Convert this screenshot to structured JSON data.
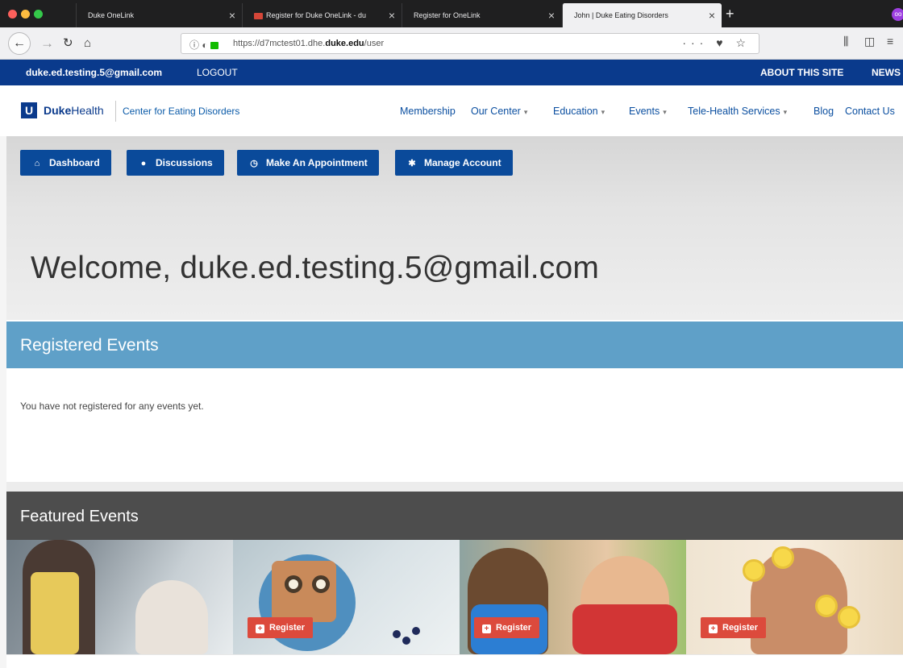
{
  "browser": {
    "tabs": [
      {
        "label": "Duke OneLink",
        "active": false
      },
      {
        "label": "Register for Duke OneLink - du",
        "active": false,
        "icon": "gmail-icon"
      },
      {
        "label": "Register for OneLink",
        "active": false
      },
      {
        "label": "John | Duke Eating Disorders",
        "active": true
      }
    ],
    "close_glyph": "×",
    "new_tab_glyph": "+",
    "url_prefix": "https://d7mctest01.dhe.",
    "url_domain": "duke.edu",
    "url_path": "/user",
    "page_actions": "··· ♥ ☆",
    "ext_badge": "oo"
  },
  "site": {
    "utility": {
      "email": "duke.ed.testing.5@gmail.com",
      "logout": "LOGOUT",
      "about": "ABOUT THIS SITE",
      "news": "NEWS"
    },
    "brand": {
      "logo_letter": "U",
      "duke": "Duke",
      "health": "Health",
      "center": "Center for Eating Disorders"
    },
    "nav": [
      {
        "label": "Membership",
        "dropdown": false
      },
      {
        "label": "Our Center",
        "dropdown": true
      },
      {
        "label": "Education",
        "dropdown": true
      },
      {
        "label": "Events",
        "dropdown": true
      },
      {
        "label": "Tele-Health Services",
        "dropdown": true
      },
      {
        "label": "Blog",
        "dropdown": false
      },
      {
        "label": "Contact Us",
        "dropdown": false
      }
    ],
    "caret": "▾",
    "actions": [
      {
        "label": "Dashboard",
        "icon": "home-icon",
        "glyph": "⌂"
      },
      {
        "label": "Discussions",
        "icon": "chat-icon",
        "glyph": "●"
      },
      {
        "label": "Make An Appointment",
        "icon": "clock-icon",
        "glyph": "◷"
      },
      {
        "label": "Manage Account",
        "icon": "gear-icon",
        "glyph": "✱"
      }
    ],
    "welcome": "Welcome, duke.ed.testing.5@gmail.com",
    "registered_title": "Registered Events",
    "no_events": "You have not registered for any events yet.",
    "featured_title": "Featured Events",
    "register_label": "Register",
    "register_glyph": "+"
  },
  "colors": {
    "duke_blue": "#0a3a8c",
    "button_blue": "#0a4a9a",
    "registered_bar": "#5fa0c8",
    "featured_bar": "#4d4d4d",
    "register_red": "#dc4a3c"
  }
}
